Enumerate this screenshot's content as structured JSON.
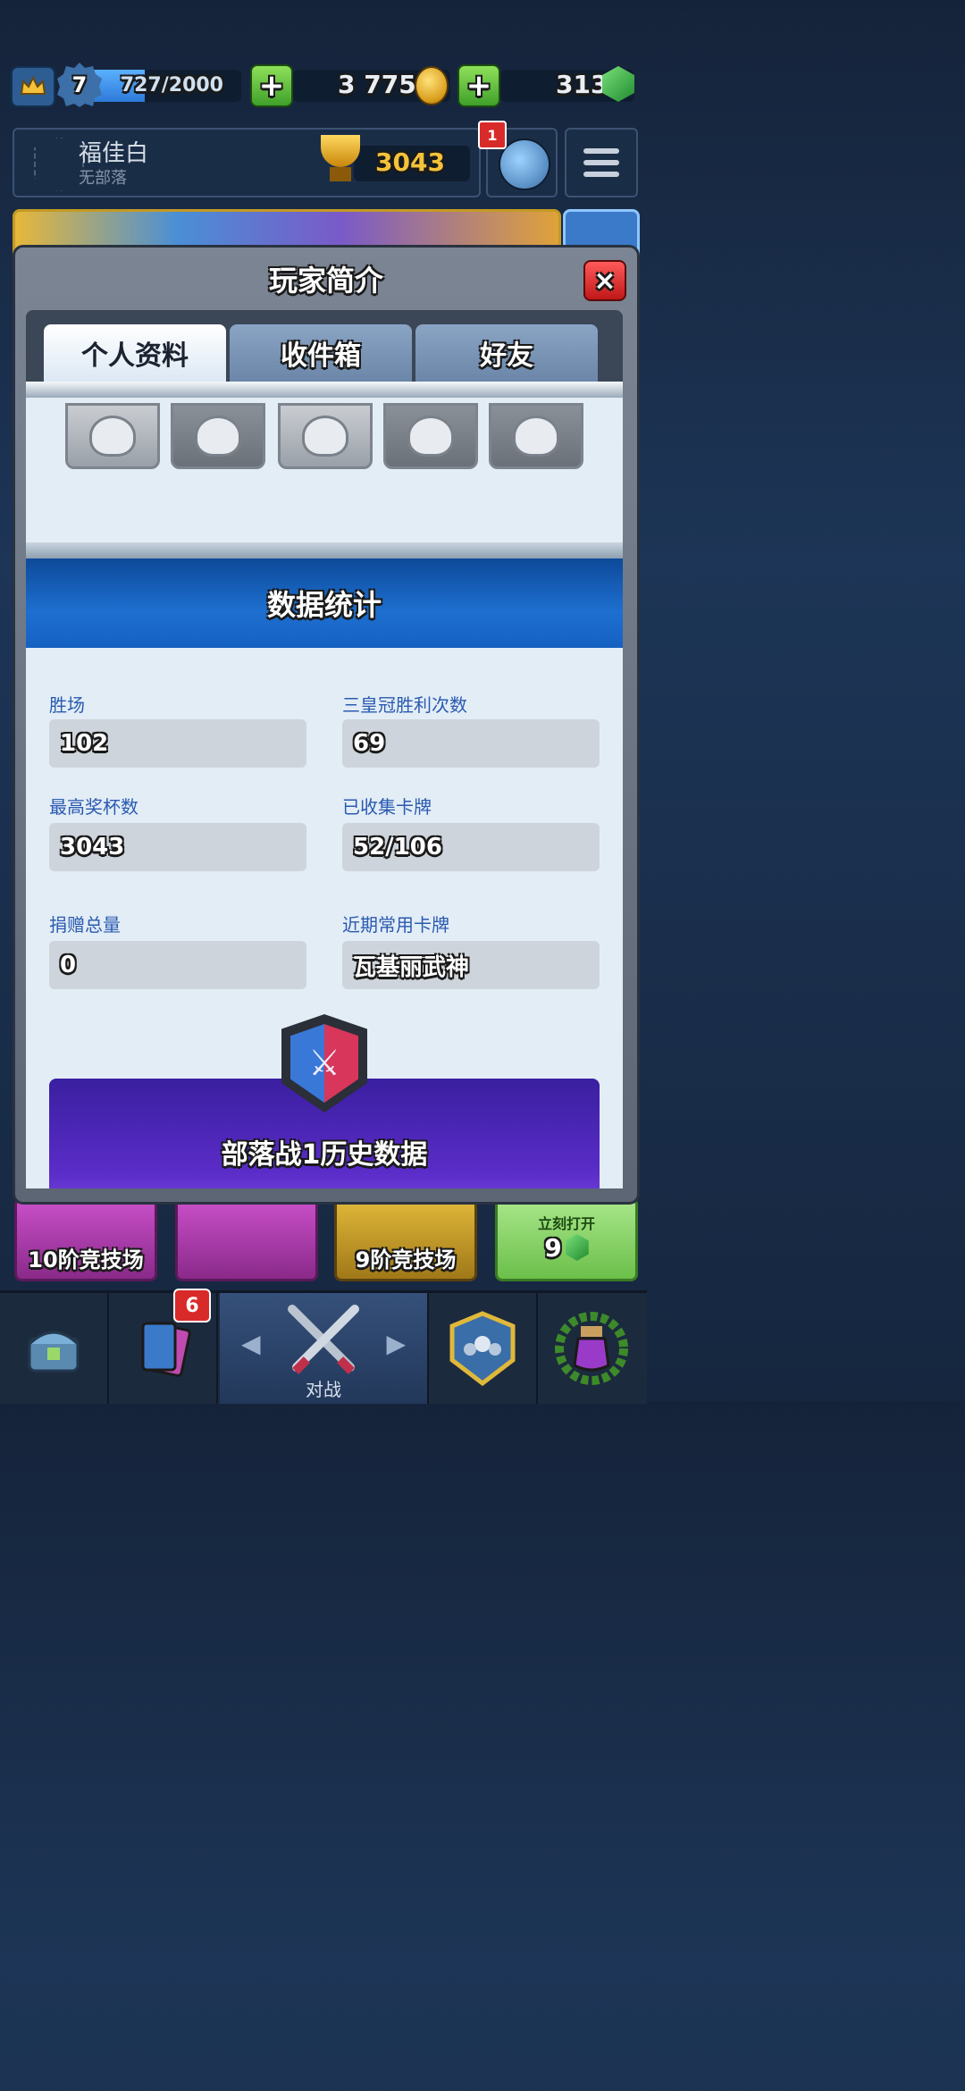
{
  "top_bar": {
    "level": "7",
    "xp_text": "727/2000",
    "xp_fraction": 0.3635,
    "gold": "3 775",
    "gems": "313"
  },
  "player": {
    "name": "福佳白",
    "clan": "无部落",
    "trophies": "3043",
    "notification_count": "1"
  },
  "modal": {
    "title": "玩家简介",
    "close_icon": "×",
    "tabs": [
      {
        "label": "个人资料",
        "active": true
      },
      {
        "label": "收件箱",
        "active": false
      },
      {
        "label": "好友",
        "active": false
      }
    ],
    "stats_header": "数据统计",
    "stats": {
      "wins_label": "胜场",
      "wins_value": "102",
      "three_crown_label": "三皇冠胜利次数",
      "three_crown_value": "69",
      "best_trophies_label": "最高奖杯数",
      "best_trophies_value": "3043",
      "cards_found_label": "已收集卡牌",
      "cards_found_value": "52/106",
      "donations_label": "捐赠总量",
      "donations_value": "0",
      "favorite_card_label": "近期常用卡牌",
      "favorite_card_value": "瓦基丽武神"
    },
    "clan_war_title": "部落战1历史数据"
  },
  "chests": [
    {
      "label": "10阶竞技场"
    },
    {
      "label": ""
    },
    {
      "label": "9阶竞技场"
    },
    {
      "label": "立刻打开",
      "cost": "9"
    }
  ],
  "bottom_nav": {
    "cards_badge": "6",
    "battle_label": "对战"
  }
}
